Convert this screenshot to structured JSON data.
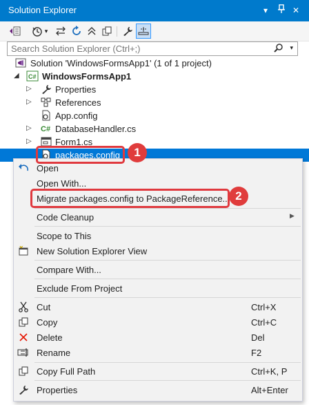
{
  "window": {
    "title": "Solution Explorer",
    "buttons": [
      "chevron-down-icon",
      "pin-icon",
      "close-icon"
    ]
  },
  "toolbar": {
    "icons": [
      "vs-solution-switch-icon",
      "history-icon",
      "chevron-down-icon",
      "sync-arrows-icon",
      "refresh-icon",
      "collapse-all-icon",
      "copy-icon",
      "wrench-icon",
      "preview-icon"
    ]
  },
  "search": {
    "placeholder": "Search Solution Explorer (Ctrl+;)"
  },
  "tree": {
    "solution": "Solution 'WindowsFormsApp1' (1 of 1 project)",
    "project": "WindowsFormsApp1",
    "items": [
      {
        "label": "Properties",
        "icon": "wrench-icon"
      },
      {
        "label": "References",
        "icon": "references-icon"
      },
      {
        "label": "App.config",
        "icon": "config-file-icon"
      },
      {
        "label": "DatabaseHandler.cs",
        "icon": "csharp-file-icon"
      },
      {
        "label": "Form1.cs",
        "icon": "form-icon"
      },
      {
        "label": "packages.config",
        "icon": "config-file-icon"
      }
    ]
  },
  "callouts": {
    "one": "1",
    "two": "2"
  },
  "menu": {
    "open": "Open",
    "open_with": "Open With...",
    "migrate": "Migrate packages.config to PackageReference...",
    "code_cleanup": "Code Cleanup",
    "scope": "Scope to This",
    "new_view": "New Solution Explorer View",
    "compare": "Compare With...",
    "exclude": "Exclude From Project",
    "cut": "Cut",
    "cut_key": "Ctrl+X",
    "copy": "Copy",
    "copy_key": "Ctrl+C",
    "delete": "Delete",
    "delete_key": "Del",
    "rename": "Rename",
    "rename_key": "F2",
    "copy_path": "Copy Full Path",
    "copy_path_key": "Ctrl+K, P",
    "properties": "Properties",
    "properties_key": "Alt+Enter"
  },
  "colors": {
    "accent": "#007acc",
    "selection": "#0078d7",
    "callout": "#e03c3c"
  }
}
